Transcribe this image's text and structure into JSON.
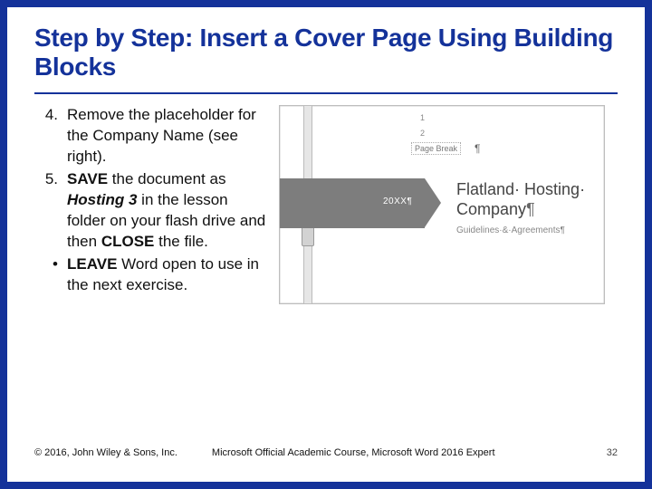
{
  "title": "Step by Step: Insert a Cover Page Using Building Blocks",
  "steps": {
    "item4": {
      "marker": "4.",
      "pre": "Remove the placeholder for the Company Name (see right)."
    },
    "item5": {
      "marker": "5.",
      "save": "SAVE",
      "mid1": " the document as ",
      "filename": "Hosting 3",
      "mid2": " in the lesson folder on your flash drive and then ",
      "close": "CLOSE",
      "post": " the file."
    },
    "item6": {
      "marker": "•",
      "leave": "LEAVE",
      "post": " Word open to use in the next exercise."
    }
  },
  "preview": {
    "ticks": {
      "t1": "1",
      "t2": "2"
    },
    "pagebreak_label": "Page Break",
    "pilcrow": "¶",
    "band_year": "20XX¶",
    "cover_line1": "Flatland· Hosting·",
    "cover_line2": "Company",
    "cover_sub": "Guidelines·&·Agreements¶"
  },
  "footer": {
    "copyright": "© 2016, John Wiley & Sons, Inc.",
    "course": "Microsoft Official Academic Course, Microsoft Word 2016 Expert",
    "page": "32"
  }
}
